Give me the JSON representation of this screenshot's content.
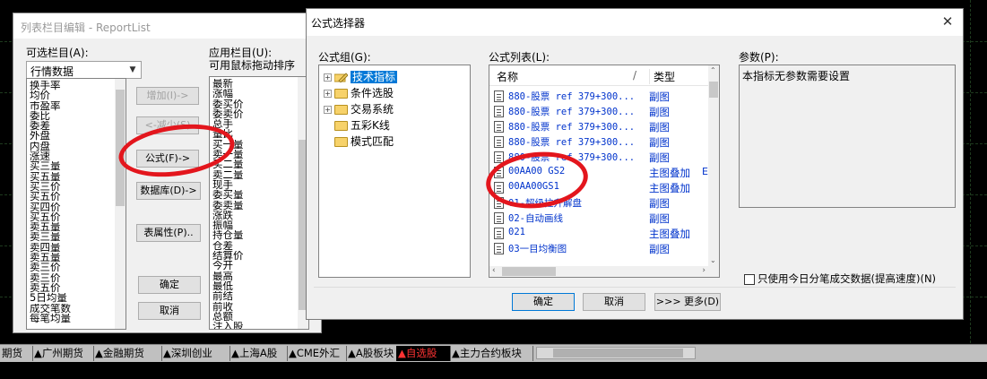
{
  "left_dialog": {
    "title": "列表栏目编辑 - ReportList",
    "available_label": "可选栏目(A):",
    "category_combo": "行情数据",
    "applied_label_1": "应用栏目(U):",
    "applied_label_2": "可用鼠标拖动排序",
    "available_items": [
      "换手率",
      "均价",
      "市盈率",
      "委比",
      "委差",
      "外盘",
      "内盘",
      "涨速",
      "买三量",
      "买五量",
      "买三价",
      "买五价",
      "买四价",
      "买五价",
      "卖五量",
      "卖三量",
      "卖四量",
      "卖五量",
      "卖三价",
      "卖三价",
      "卖五价",
      "5日均量",
      "成交笔数",
      "每笔均量"
    ],
    "applied_items": [
      "最新",
      "涨幅",
      "委买价",
      "委卖价",
      "总手",
      "量比",
      "买一量",
      "卖一量",
      "买二量",
      "卖二量",
      "现手",
      "委买量",
      "委卖量",
      "涨跌",
      "振幅",
      "持仓量",
      "仓差",
      "结算价",
      "今开",
      "最高",
      "最低",
      "前结",
      "前收",
      "总额",
      "注入股"
    ],
    "buttons": {
      "add": "增加(I)->",
      "remove": "<-减少(S)",
      "formula": "公式(F)->",
      "database": "数据库(D)->",
      "table_attr": "表属性(P)..",
      "ok": "确定",
      "cancel": "取消"
    }
  },
  "right_dialog": {
    "title": "公式选择器",
    "close_icon": "close-icon",
    "group_label": "公式组(G):",
    "list_label": "公式列表(L):",
    "params_label": "参数(P):",
    "tree": [
      {
        "label": "技术指标",
        "selected": true,
        "expandable": true
      },
      {
        "label": "条件选股",
        "selected": false,
        "expandable": true
      },
      {
        "label": "交易系统",
        "selected": false,
        "expandable": true
      },
      {
        "label": "五彩K线",
        "selected": false,
        "expandable": false
      },
      {
        "label": "模式匹配",
        "selected": false,
        "expandable": false
      }
    ],
    "columns": {
      "name": "名称",
      "type": "类型",
      "sort_mark": "/"
    },
    "formulas": [
      {
        "name": "880-股票 ref 379+300...",
        "type": "副图",
        "extra": ""
      },
      {
        "name": "880-股票 ref 379+300...",
        "type": "副图",
        "extra": ""
      },
      {
        "name": "880-股票 ref 379+300...",
        "type": "副图",
        "extra": ""
      },
      {
        "name": "880-股票 ref 379+300...",
        "type": "副图",
        "extra": ""
      },
      {
        "name": "880-股票 ref 379+300...",
        "type": "副图",
        "extra": ""
      },
      {
        "name": "00AA00 GS2",
        "type": "主图叠加",
        "extra": "E"
      },
      {
        "name": "00AA00GS1",
        "type": "主图叠加",
        "extra": ""
      },
      {
        "name": "01-超级拉升解盘",
        "type": "副图",
        "extra": ""
      },
      {
        "name": "02-自动画线",
        "type": "副图",
        "extra": ""
      },
      {
        "name": "021",
        "type": "主图叠加",
        "extra": ""
      },
      {
        "name": "03一目均衡图",
        "type": "副图",
        "extra": ""
      }
    ],
    "params_text": "本指标无参数需要设置",
    "checkbox_label": "只使用今日分笔成交数据(提高速度)(N)",
    "buttons": {
      "ok": "确定",
      "cancel": "取消",
      "more": ">>> 更多(D)"
    }
  },
  "tabs": [
    {
      "label": "期货",
      "active": false
    },
    {
      "label": "▲广州期货",
      "active": false
    },
    {
      "label": "▲金融期货",
      "active": false
    },
    {
      "label": "▲深圳创业",
      "active": false
    },
    {
      "label": "▲上海A股",
      "active": false
    },
    {
      "label": "▲CME外汇",
      "active": false
    },
    {
      "label": "▲A股板块",
      "active": false
    },
    {
      "label": "▲自选股",
      "active": true
    },
    {
      "label": "▲主力合约板块",
      "active": false
    }
  ],
  "colors": {
    "annotation": "#e3161d",
    "selection": "#0078d7",
    "formula_text": "#0033cc",
    "active_tab": "#ff3333"
  }
}
